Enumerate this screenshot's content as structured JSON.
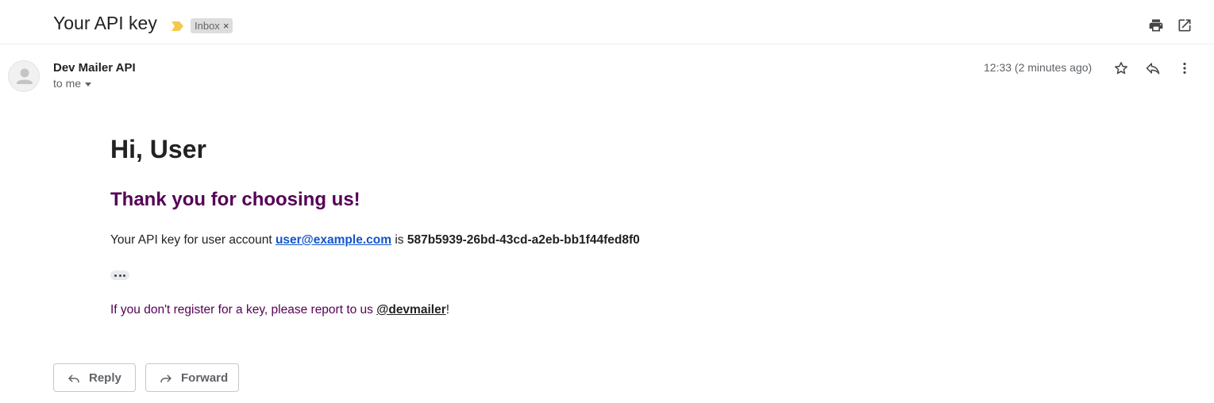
{
  "header": {
    "subject": "Your API key",
    "label": "Inbox",
    "label_close": "×",
    "icons": [
      "print-icon",
      "open-in-new-window-icon"
    ]
  },
  "message": {
    "sender": "Dev Mailer API",
    "recipient": "to me",
    "timestamp": "12:33 (2 minutes ago)",
    "icons": [
      "star-icon",
      "reply-icon",
      "more-options-icon"
    ]
  },
  "body": {
    "greeting": "Hi, User",
    "thanks": "Thank you for choosing us!",
    "key_prefix": "Your API key for user account ",
    "email": "user@example.com",
    "key_mid": " is ",
    "api_key": "587b5939-26bd-43cd-a2eb-bb1f44fed8f0",
    "report_prefix": "If you don't register for a key, please report to us ",
    "handle": "@devmailer",
    "report_suffix": "!"
  },
  "actions": {
    "reply_label": "Reply",
    "forward_label": "Forward"
  },
  "colors": {
    "importance_marker": "#f2c94c",
    "accent_purple": "#550055",
    "link_blue": "#1155cc"
  }
}
